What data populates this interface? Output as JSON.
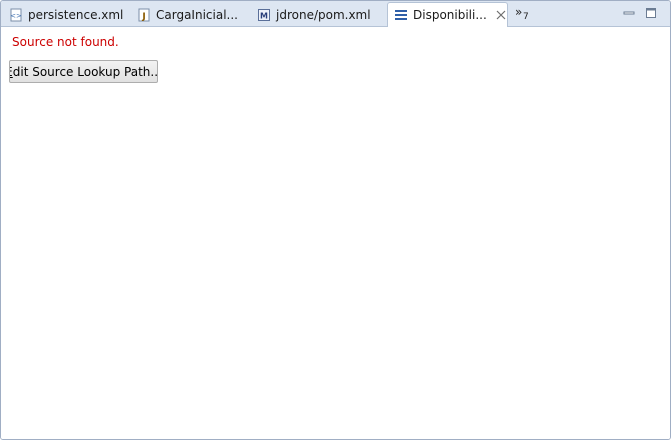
{
  "tabs": [
    {
      "label": "persistence.xml",
      "icon": "xml-file-icon",
      "active": false
    },
    {
      "label": "CargaInicial...",
      "icon": "java-file-icon",
      "active": false
    },
    {
      "label": "jdrone/pom.xml",
      "icon": "maven-pom-icon",
      "active": false
    },
    {
      "label": "Disponibili...",
      "icon": "class-file-icon",
      "active": true
    }
  ],
  "overflow": {
    "chevron": "»",
    "count": "7"
  },
  "content": {
    "message": "Source not found.",
    "button_mnemonic": "E",
    "button_rest": "dit Source Lookup Path..."
  },
  "colors": {
    "message": "#cc0000",
    "tab_bar": "#dde6f2",
    "frame_border": "#a0aec4"
  }
}
